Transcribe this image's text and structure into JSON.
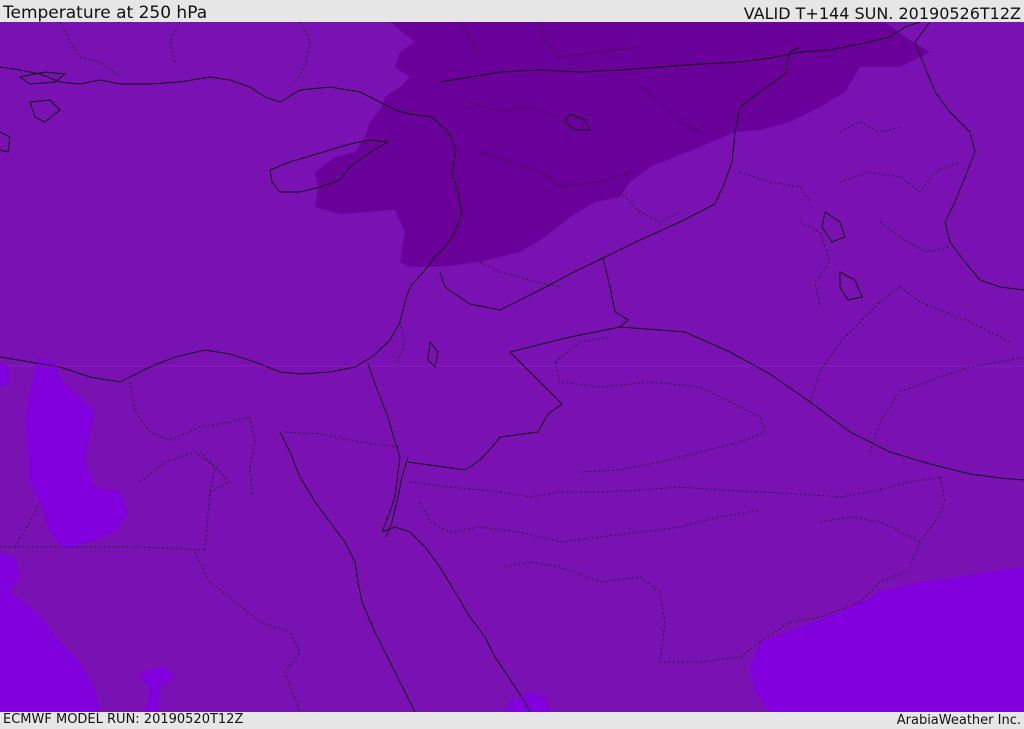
{
  "header": {
    "title": "Temperature at 250 hPa",
    "valid": "VALID T+144 SUN. 20190526T12Z"
  },
  "footer": {
    "model_run": "ECMWF MODEL RUN: 20190520T12Z",
    "credit": "ArabiaWeather Inc."
  },
  "map": {
    "colors": {
      "base": "#7a12b3",
      "cold": "#6a0099",
      "warm": "#8100dd",
      "border": "#111111"
    }
  }
}
